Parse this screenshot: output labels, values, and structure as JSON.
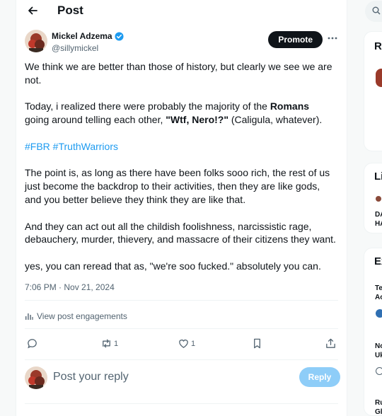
{
  "header": {
    "title": "Post"
  },
  "author": {
    "name": "Mickel Adzema",
    "handle": "@sillymickel"
  },
  "promote_label": "Promote",
  "post": {
    "p1": "We think we are better than those of history, but clearly we see we are not.",
    "p2_a": "Today, i realized there were probably the majority of the ",
    "p2_b": "Romans",
    "p2_c": " going around telling each other, ",
    "p2_d": "\"Wtf, Nero!?\"",
    "p2_e": " (Caligula, whatever).",
    "hashtags": "#FBR #TruthWarriors",
    "p3": "The point is, as long as there have been folks sooo rich, the rest of us just become the backdrop to their activities, then they are like gods, and you better believe they think they are like that.",
    "p4": "And they can act out all the childish foolishness, narcissistic rage, debauchery, murder, thievery, and massacre of their citizens they want.",
    "p5": "yes, you can reread that as, \"we're soo fucked.\" absolutely you can."
  },
  "timestamp": "7:06 PM · Nov 21, 2024",
  "engagements_label": "View post engagements",
  "actions": {
    "retweets": "1",
    "likes": "1"
  },
  "reply": {
    "placeholder": "Post your reply",
    "button": "Reply"
  },
  "sidebar": {
    "card1_heading": "Re",
    "card2_heading": "Li",
    "card2_text": "DA\nHA",
    "card3_heading": "Ex",
    "card3_items": [
      "Te\nAc",
      "No\nUk",
      "Ru\nGl"
    ]
  },
  "colors": {
    "accent": "#1d9bf0",
    "reply_disabled": "#8ecdf8"
  }
}
